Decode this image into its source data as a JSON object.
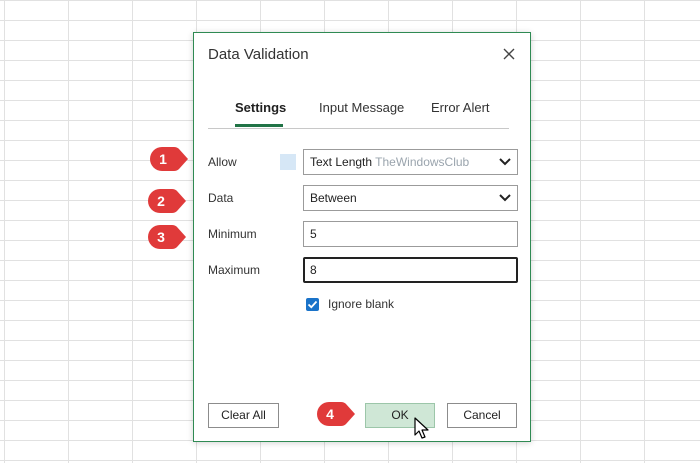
{
  "dialog": {
    "title": "Data Validation",
    "close_icon": "close-icon"
  },
  "tabs": [
    {
      "label": "Settings",
      "active": true
    },
    {
      "label": "Input Message",
      "active": false
    },
    {
      "label": "Error Alert",
      "active": false
    }
  ],
  "fields": {
    "allow": {
      "label": "Allow",
      "value": "Text Length"
    },
    "data": {
      "label": "Data",
      "value": "Between"
    },
    "minimum": {
      "label": "Minimum",
      "value": "5"
    },
    "maximum": {
      "label": "Maximum",
      "value": "8"
    }
  },
  "watermark": "TheWindowsClub",
  "checkbox": {
    "label": "Ignore blank",
    "checked": true
  },
  "buttons": {
    "clear_all": "Clear All",
    "ok": "OK",
    "cancel": "Cancel"
  },
  "callouts": [
    "1",
    "2",
    "3",
    "4"
  ],
  "colors": {
    "accent": "#217346",
    "callout": "#e03a3a",
    "ok_bg": "#cfe7d6",
    "checkbox": "#1a73c9"
  }
}
